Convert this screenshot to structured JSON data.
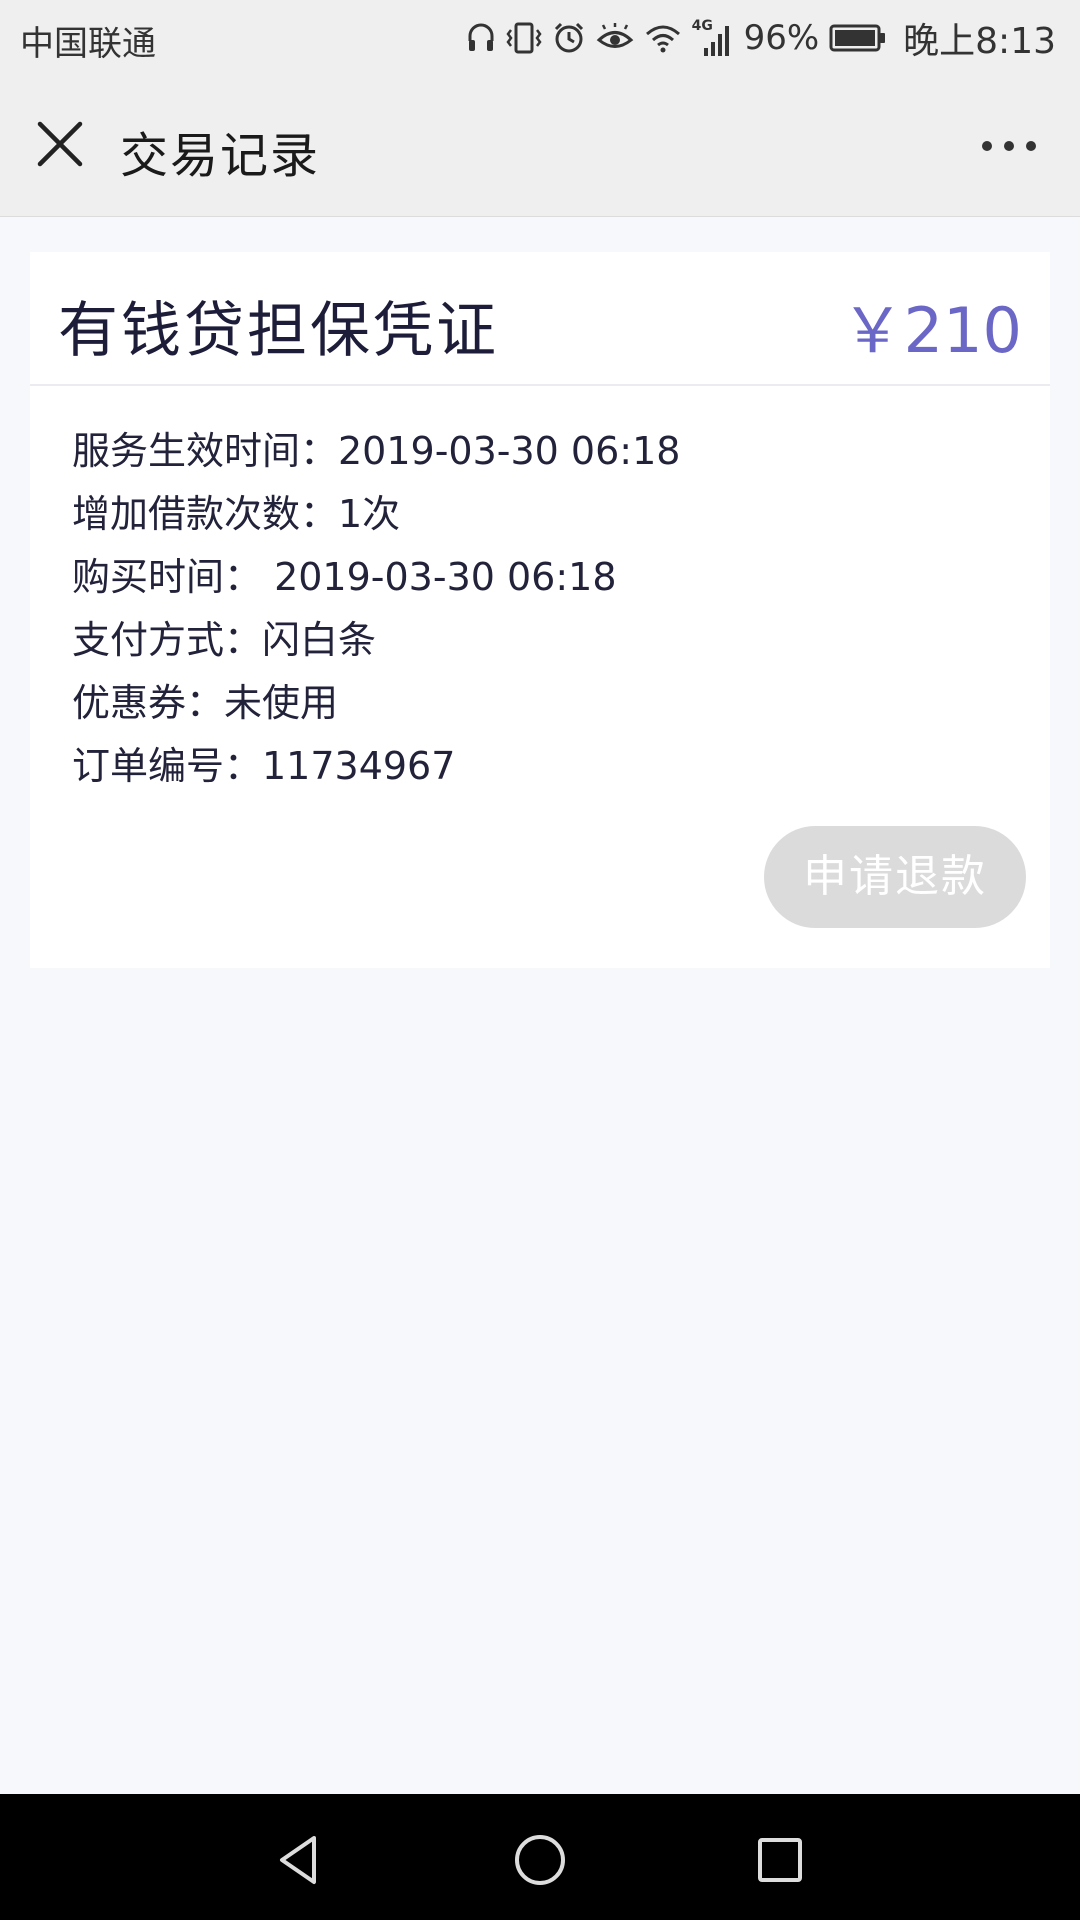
{
  "status_bar": {
    "carrier": "中国联通",
    "network": "4G",
    "battery": "96%",
    "time": "晚上8:13",
    "icons": [
      "headset-icon",
      "vibrate-icon",
      "alarm-icon",
      "eye-icon",
      "wifi-icon",
      "signal-icon",
      "battery-icon"
    ]
  },
  "title_bar": {
    "title": "交易记录",
    "close_icon": "close-icon",
    "more_icon": "more-icon"
  },
  "record": {
    "product": "有钱贷担保凭证",
    "price": "￥210",
    "details": [
      "服务生效时间：2019-03-30 06:18",
      "增加借款次数：1次",
      "购买时间： 2019-03-30 06:18",
      "支付方式：闪白条",
      "优惠券：未使用",
      "订单编号：11734967"
    ],
    "refund_label": "申请退款",
    "refund_enabled": false
  },
  "nav_bar": {
    "buttons": [
      "back-icon",
      "home-icon",
      "recents-icon"
    ]
  },
  "colors": {
    "price": "#6b67c7",
    "disabled_button": "#dbdbdb",
    "page_background": "#f7f8fc",
    "header_background": "#efefef"
  }
}
